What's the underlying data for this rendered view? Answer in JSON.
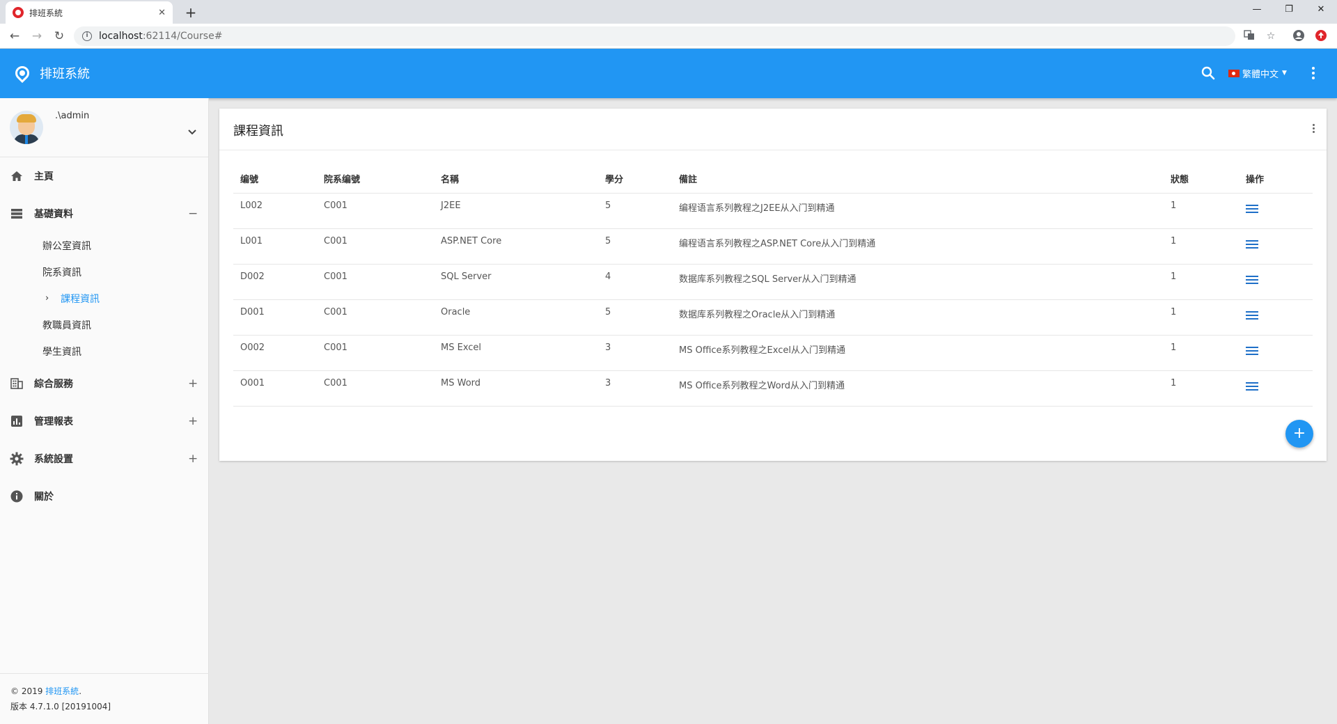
{
  "browser": {
    "tab_title": "排班系統",
    "close_glyph": "✕",
    "new_tab_glyph": "+",
    "url_host": "localhost",
    "url_path": ":62114/Course#",
    "win_minimize": "—",
    "win_restore": "❐",
    "win_close": "✕"
  },
  "header": {
    "title": "排班系統",
    "language": "繁體中文",
    "caret": "▼",
    "accent_color": "#2196f3"
  },
  "user": {
    "name": ".\\admin"
  },
  "sidebar": {
    "items": [
      {
        "label": "主頁",
        "icon": "home-icon"
      },
      {
        "label": "基礎資料",
        "icon": "list-icon",
        "toggle": "−"
      },
      {
        "label": "綜合服務",
        "icon": "building-icon",
        "toggle": "+"
      },
      {
        "label": "管理報表",
        "icon": "chart-icon",
        "toggle": "+"
      },
      {
        "label": "系統設置",
        "icon": "gear-icon",
        "toggle": "+"
      },
      {
        "label": "關於",
        "icon": "info-icon"
      }
    ],
    "sub_items": [
      {
        "label": "辦公室資訊"
      },
      {
        "label": "院系資訊"
      },
      {
        "label": "課程資訊",
        "active": true,
        "chevron": "›"
      },
      {
        "label": "教職員資訊"
      },
      {
        "label": "學生資訊"
      }
    ]
  },
  "footer": {
    "copyright": "© 2019 ",
    "brand": "排班系統",
    "dot": ".",
    "version": "版本 4.7.1.0 [20191004]"
  },
  "card": {
    "title": "課程資訊",
    "columns": [
      "编號",
      "院系编號",
      "名稱",
      "學分",
      "備註",
      "狀態",
      "操作"
    ],
    "rows": [
      [
        "L002",
        "C001",
        "J2EE",
        "5",
        "编程语言系列教程之J2EE从入门到精通",
        "1"
      ],
      [
        "L001",
        "C001",
        "ASP.NET Core",
        "5",
        "编程语言系列教程之ASP.NET Core从入门到精通",
        "1"
      ],
      [
        "D002",
        "C001",
        "SQL Server",
        "4",
        "数据库系列教程之SQL Server从入门到精通",
        "1"
      ],
      [
        "D001",
        "C001",
        "Oracle",
        "5",
        "数据库系列教程之Oracle从入门到精通",
        "1"
      ],
      [
        "O002",
        "C001",
        "MS Excel",
        "3",
        "MS Office系列教程之Excel从入门到精通",
        "1"
      ],
      [
        "O001",
        "C001",
        "MS Word",
        "3",
        "MS Office系列教程之Word从入门到精通",
        "1"
      ]
    ],
    "fab_label": "+"
  }
}
